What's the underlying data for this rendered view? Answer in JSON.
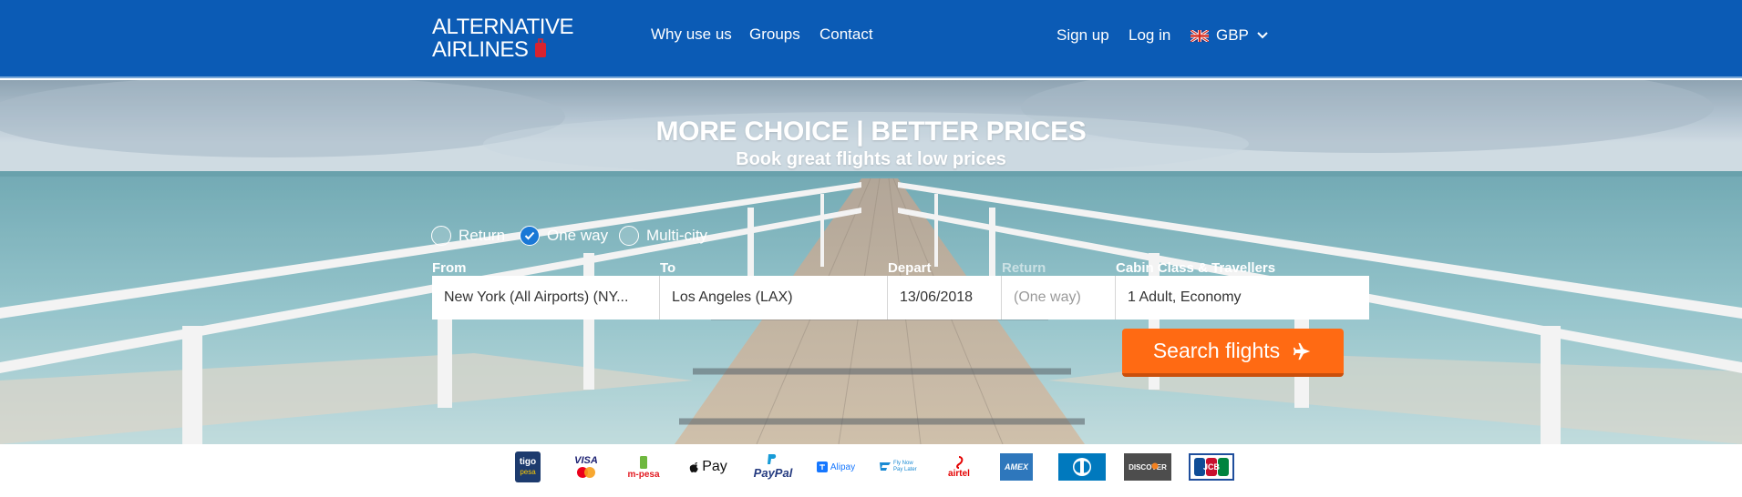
{
  "header": {
    "logo_line1": "ALTERNATIVE",
    "logo_line2": "AIRLINES",
    "nav": {
      "why": "Why use us",
      "groups": "Groups",
      "contact": "Contact"
    },
    "signup": "Sign up",
    "login": "Log in",
    "currency": "GBP",
    "brand_color": "#0b5bb5"
  },
  "hero": {
    "title": "MORE CHOICE | BETTER PRICES",
    "subtitle": "Book great flights at low prices"
  },
  "search": {
    "trip_types": {
      "return": "Return",
      "one_way": "One way",
      "multi_city": "Multi-city",
      "selected": "One way"
    },
    "labels": {
      "from": "From",
      "to": "To",
      "depart": "Depart",
      "return": "Return",
      "cabin": "Cabin Class & Travellers"
    },
    "values": {
      "from": "New York (All Airports) (NY...",
      "to": "Los Angeles (LAX)",
      "depart": "13/06/2018",
      "return_placeholder": "(One way)",
      "cabin": "1 Adult, Economy"
    },
    "button_label": "Search flights",
    "button_color": "#ff6a13"
  },
  "payments": {
    "tigo": "tigo",
    "tigo_sub": "pesa",
    "visa": "VISA",
    "mpesa": "m-pesa",
    "applepay": "Pay",
    "paypal": "PayPal",
    "alipay": "Alipay",
    "flynow": "Fly Now Pay Later",
    "airtel": "airtel",
    "amex": "AMEX",
    "discover": "DISCOVER",
    "jcb": "JCB"
  }
}
